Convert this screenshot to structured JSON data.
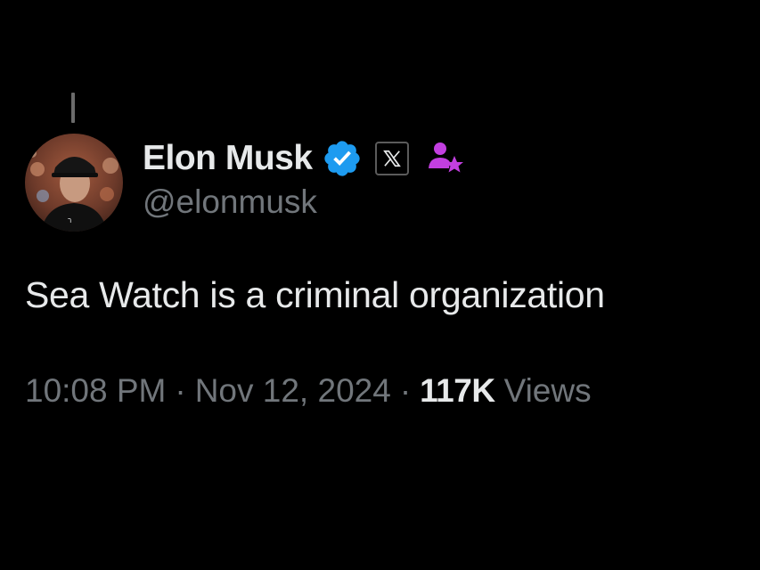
{
  "tweet": {
    "author": {
      "display_name": "Elon Musk",
      "handle": "@elonmusk",
      "avatar_icon": "profile-photo",
      "verified_icon": "verified-badge-icon",
      "affiliate_icon": "x-logo-icon",
      "creator_icon": "creator-person-star-icon"
    },
    "text": "Sea Watch is a criminal organization",
    "time": "10:08 PM",
    "separator": "·",
    "date": "Nov 12, 2024",
    "views_count": "117K",
    "views_label": "Views"
  },
  "colors": {
    "background": "#000000",
    "primary_text": "#e7e9ea",
    "secondary_text": "#71767b",
    "verified_blue": "#1d9bf0",
    "creator_purple": "#c23fe0"
  }
}
